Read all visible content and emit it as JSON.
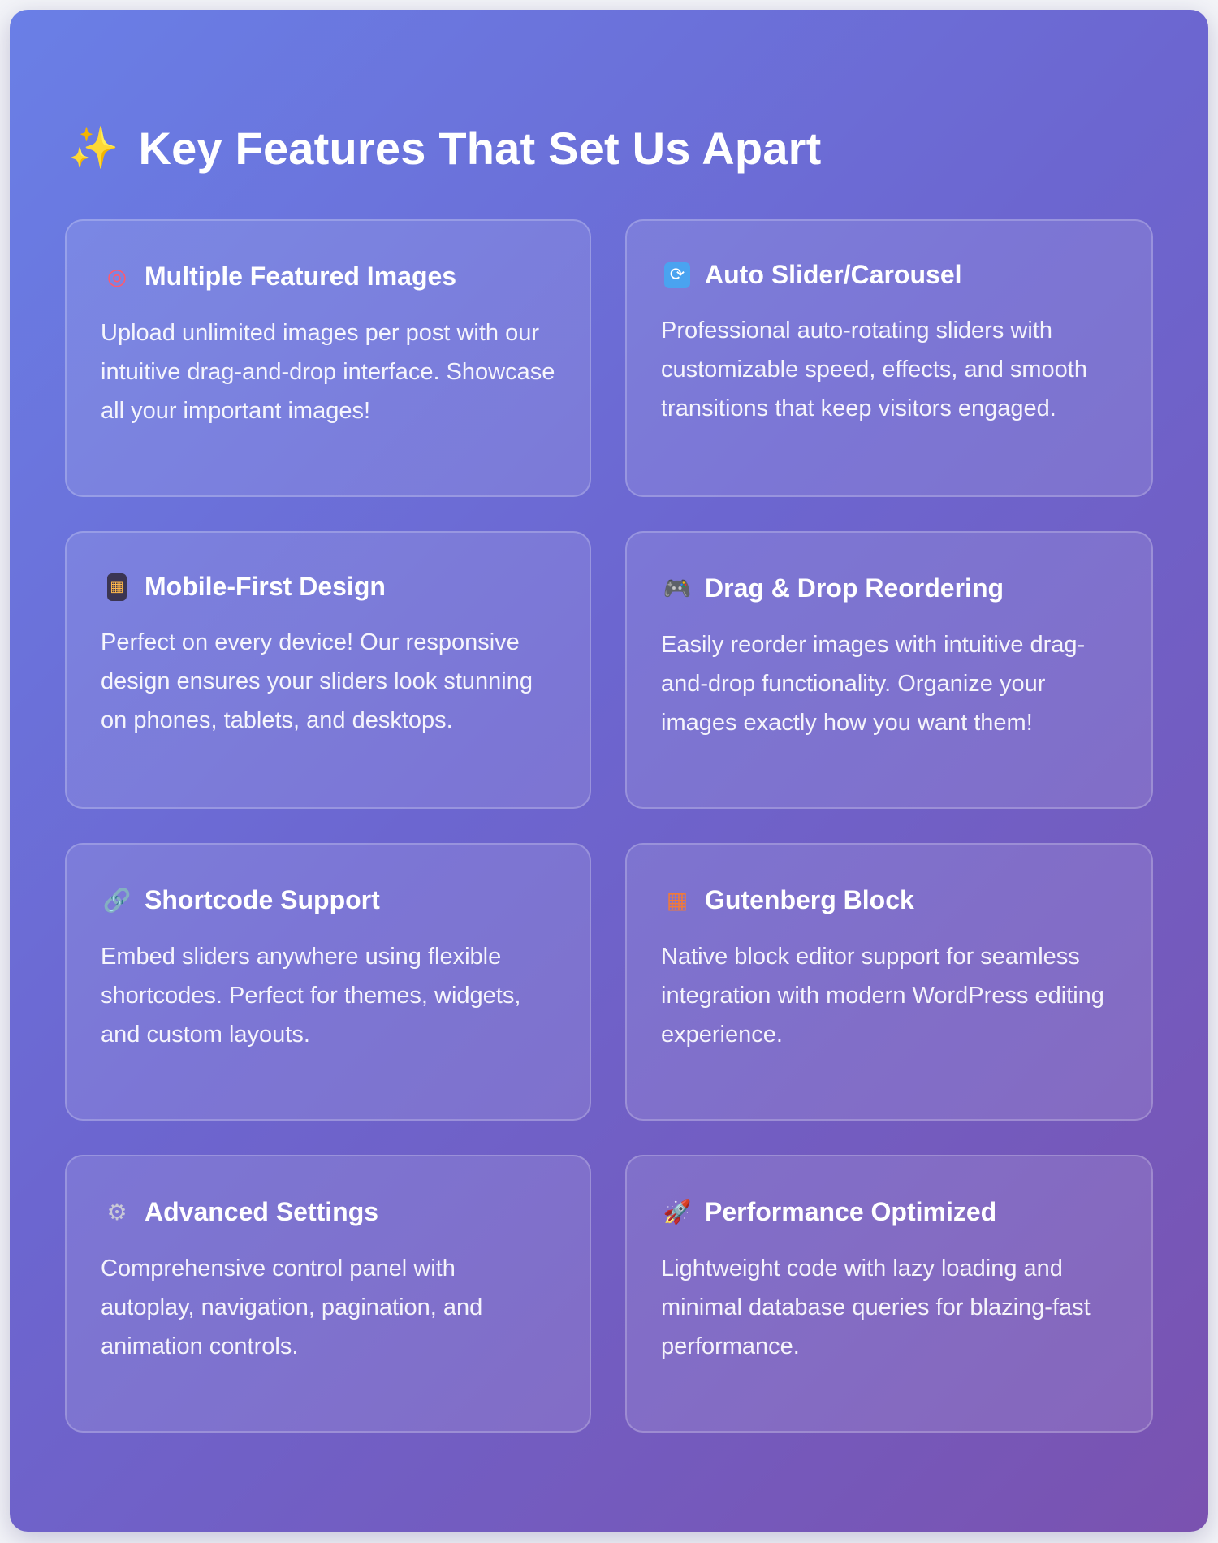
{
  "header": {
    "emoji": "✨",
    "title": "Key Features That Set Us Apart"
  },
  "features": [
    {
      "icon": "target-icon",
      "icon_glyph": "◎",
      "title": "Multiple Featured Images",
      "description": "Upload unlimited images per post with our intuitive drag-and-drop interface. Showcase all your important images!"
    },
    {
      "icon": "refresh-icon",
      "icon_glyph": "⟳",
      "title": "Auto Slider/Carousel",
      "description": "Professional auto-rotating sliders with customizable speed, effects, and smooth transitions that keep visitors engaged."
    },
    {
      "icon": "mobile-phone-icon",
      "icon_glyph": "▦",
      "title": "Mobile-First Design",
      "description": "Perfect on every device! Our responsive design ensures your sliders look stunning on phones, tablets, and desktops."
    },
    {
      "icon": "game-controller-icon",
      "icon_glyph": "🎮",
      "title": "Drag & Drop Reordering",
      "description": "Easily reorder images with intuitive drag-and-drop functionality. Organize your images exactly how you want them!"
    },
    {
      "icon": "link-icon",
      "icon_glyph": "🔗",
      "title": "Shortcode Support",
      "description": "Embed sliders anywhere using flexible shortcodes. Perfect for themes, widgets, and custom layouts."
    },
    {
      "icon": "brick-icon",
      "icon_glyph": "▦",
      "title": "Gutenberg Block",
      "description": "Native block editor support for seamless integration with modern WordPress editing experience."
    },
    {
      "icon": "gear-icon",
      "icon_glyph": "⚙",
      "title": "Advanced Settings",
      "description": "Comprehensive control panel with autoplay, navigation, pagination, and animation controls."
    },
    {
      "icon": "rocket-icon",
      "icon_glyph": "🚀",
      "title": "Performance Optimized",
      "description": "Lightweight code with lazy loading and minimal database queries for blazing-fast performance."
    }
  ]
}
